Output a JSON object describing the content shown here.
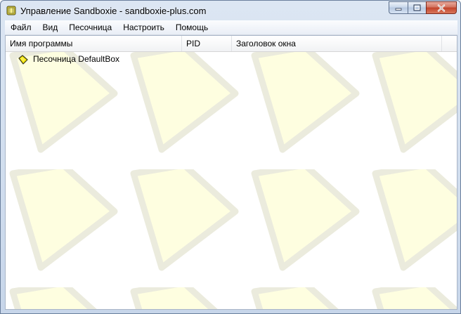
{
  "window": {
    "title": "Управление Sandboxie - sandboxie-plus.com"
  },
  "menu": {
    "items": [
      {
        "id": "file",
        "label": "Файл"
      },
      {
        "id": "view",
        "label": "Вид"
      },
      {
        "id": "sandbox",
        "label": "Песочница"
      },
      {
        "id": "configure",
        "label": "Настроить"
      },
      {
        "id": "help",
        "label": "Помощь"
      }
    ]
  },
  "table": {
    "columns": [
      {
        "id": "program",
        "label": "Имя программы"
      },
      {
        "id": "pid",
        "label": "PID"
      },
      {
        "id": "window-title",
        "label": "Заголовок окна"
      }
    ],
    "rows": [
      {
        "label": "Песочница DefaultBox",
        "icon": "sandbox-icon"
      }
    ]
  },
  "colors": {
    "background_pattern": "#fefee0",
    "background_pattern_border": "#ececdc",
    "sandbox_icon_fill": "#f5e600"
  }
}
